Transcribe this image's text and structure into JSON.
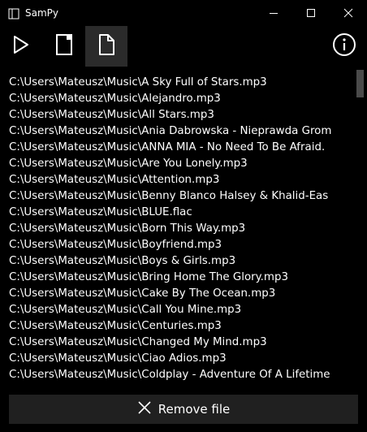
{
  "window": {
    "title": "SamPy"
  },
  "titlebar": {
    "app_icon": "window-icon",
    "minimize_icon": "minimize-icon",
    "maximize_icon": "maximize-icon",
    "close_icon": "close-icon"
  },
  "toolbar": {
    "play_icon": "play-icon",
    "document_icon": "document-icon",
    "file_icon": "file-icon",
    "info_icon": "info-icon"
  },
  "files": [
    "C:\\Users\\Mateusz\\Music\\A Sky Full of Stars.mp3",
    "C:\\Users\\Mateusz\\Music\\Alejandro.mp3",
    "C:\\Users\\Mateusz\\Music\\All Stars.mp3",
    "C:\\Users\\Mateusz\\Music\\Ania Dabrowska - Nieprawda Grom",
    "C:\\Users\\Mateusz\\Music\\ANNA MIA - No Need To Be Afraid.",
    "C:\\Users\\Mateusz\\Music\\Are You Lonely.mp3",
    "C:\\Users\\Mateusz\\Music\\Attention.mp3",
    "C:\\Users\\Mateusz\\Music\\Benny Blanco Halsey & Khalid-Eas",
    "C:\\Users\\Mateusz\\Music\\BLUE.flac",
    "C:\\Users\\Mateusz\\Music\\Born This Way.mp3",
    "C:\\Users\\Mateusz\\Music\\Boyfriend.mp3",
    "C:\\Users\\Mateusz\\Music\\Boys & Girls.mp3",
    "C:\\Users\\Mateusz\\Music\\Bring Home The Glory.mp3",
    "C:\\Users\\Mateusz\\Music\\Cake By The Ocean.mp3",
    "C:\\Users\\Mateusz\\Music\\Call You Mine.mp3",
    "C:\\Users\\Mateusz\\Music\\Centuries.mp3",
    "C:\\Users\\Mateusz\\Music\\Changed My Mind.mp3",
    "C:\\Users\\Mateusz\\Music\\Ciao Adios.mp3",
    "C:\\Users\\Mateusz\\Music\\Coldplay - Adventure Of A Lifetime"
  ],
  "actions": {
    "remove_label": "Remove file",
    "remove_icon": "x-icon"
  },
  "colors": {
    "background": "#000000",
    "selected_tool": "#2b2b2b",
    "button": "#202020",
    "scrollbar_thumb": "#4a4a4a",
    "text": "#ffffff"
  }
}
